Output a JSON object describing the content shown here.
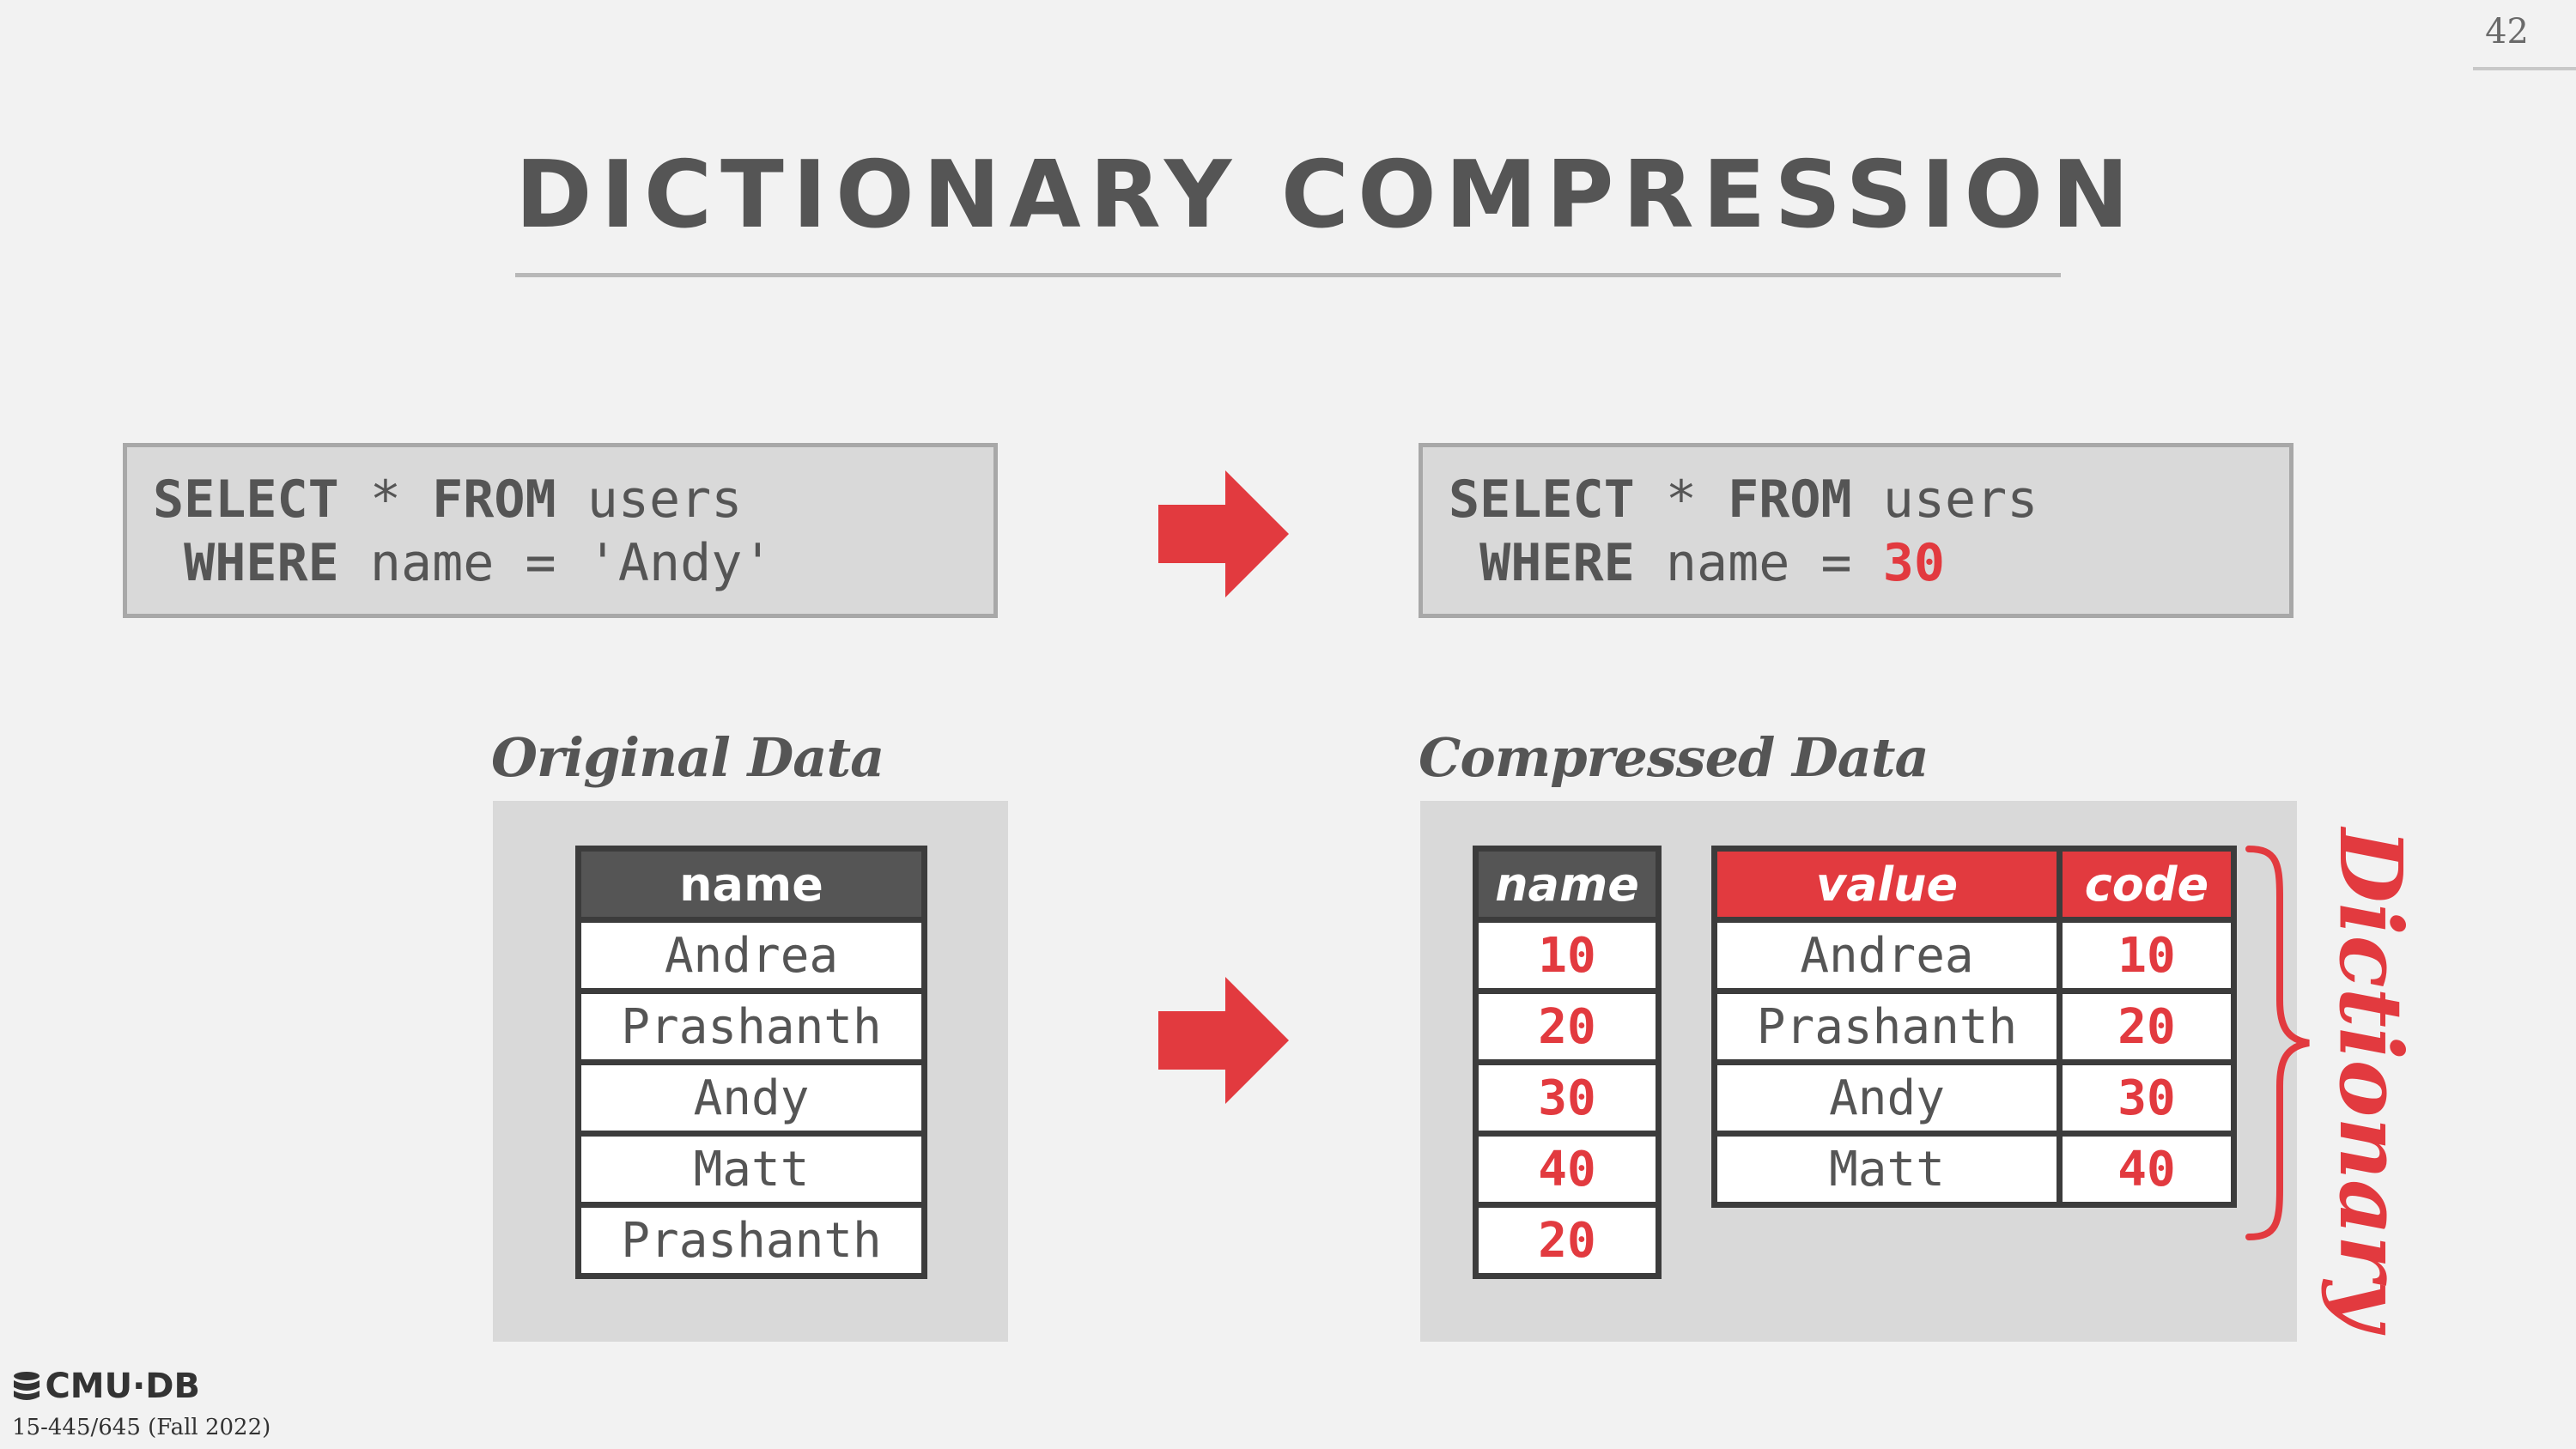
{
  "page_number": "42",
  "title": "DICTIONARY COMPRESSION",
  "query_original": {
    "line1_kw1": "SELECT",
    "line1_mid": " * ",
    "line1_kw2": "FROM",
    "line1_rest": " users",
    "line2_kw": " WHERE",
    "line2_rest": " name = 'Andy'"
  },
  "query_compressed": {
    "line1_kw1": "SELECT",
    "line1_mid": " * ",
    "line1_kw2": "FROM",
    "line1_rest": " users",
    "line2_kw": " WHERE",
    "line2_rest": " name = ",
    "line2_value": "30"
  },
  "original_label": "Original Data",
  "compressed_label": "Compressed Data",
  "original_table": {
    "header": "name",
    "rows": [
      "Andrea",
      "Prashanth",
      "Andy",
      "Matt",
      "Prashanth"
    ]
  },
  "compressed_table": {
    "header": "name",
    "rows": [
      "10",
      "20",
      "30",
      "40",
      "20"
    ]
  },
  "dictionary_table": {
    "headers": [
      "value",
      "code"
    ],
    "rows": [
      [
        "Andrea",
        "10"
      ],
      [
        "Prashanth",
        "20"
      ],
      [
        "Andy",
        "30"
      ],
      [
        "Matt",
        "40"
      ]
    ]
  },
  "dictionary_label": "Dictionary",
  "logo_text": "CMU·DB",
  "course": "15-445/645 (Fall 2022)",
  "colors": {
    "accent": "#e23a3f",
    "header_dark": "#555555",
    "panel": "#d9d9d9",
    "background": "#f2f2f2"
  }
}
